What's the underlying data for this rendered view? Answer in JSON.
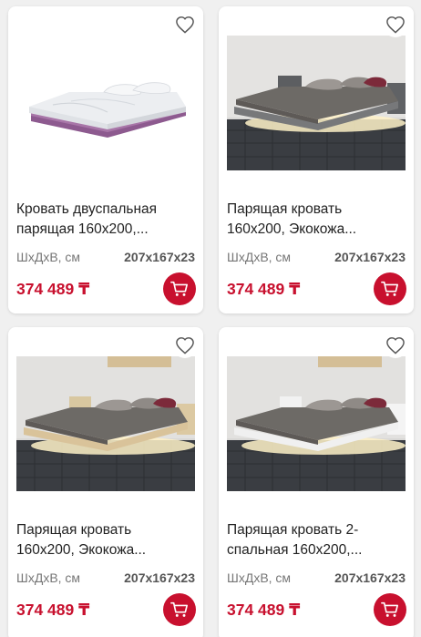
{
  "currency_symbol": "₸",
  "accent_color": "#c8102e",
  "products": [
    {
      "title_line1": "Кровать двуспальная",
      "title_line2": "парящая 160х200,...",
      "spec_label": "ШхДхВ, см",
      "spec_value": "207x167x23",
      "price": "374 489 ₸",
      "image": "white-bed-purple-frame",
      "favorite_icon": "heart-outline-icon",
      "cart_icon": "cart-icon"
    },
    {
      "title_line1": "Парящая кровать",
      "title_line2": "160х200, Экокожа...",
      "spec_label": "ШхДхВ, см",
      "spec_value": "207x167x23",
      "price": "374 489 ₸",
      "image": "floating-bed-grey-led-room",
      "favorite_icon": "heart-outline-icon",
      "cart_icon": "cart-icon"
    },
    {
      "title_line1": "Парящая кровать",
      "title_line2": "160х200, Экокожа...",
      "spec_label": "ШхДхВ, см",
      "spec_value": "207x167x23",
      "price": "374 489 ₸",
      "image": "floating-bed-beige-led-room",
      "favorite_icon": "heart-outline-icon",
      "cart_icon": "cart-icon"
    },
    {
      "title_line1": "Парящая кровать 2-",
      "title_line2": "спальная 160х200,...",
      "spec_label": "ШхДхВ, см",
      "spec_value": "207x167x23",
      "price": "374 489 ₸",
      "image": "floating-bed-white-led-room",
      "favorite_icon": "heart-outline-icon",
      "cart_icon": "cart-icon"
    }
  ]
}
